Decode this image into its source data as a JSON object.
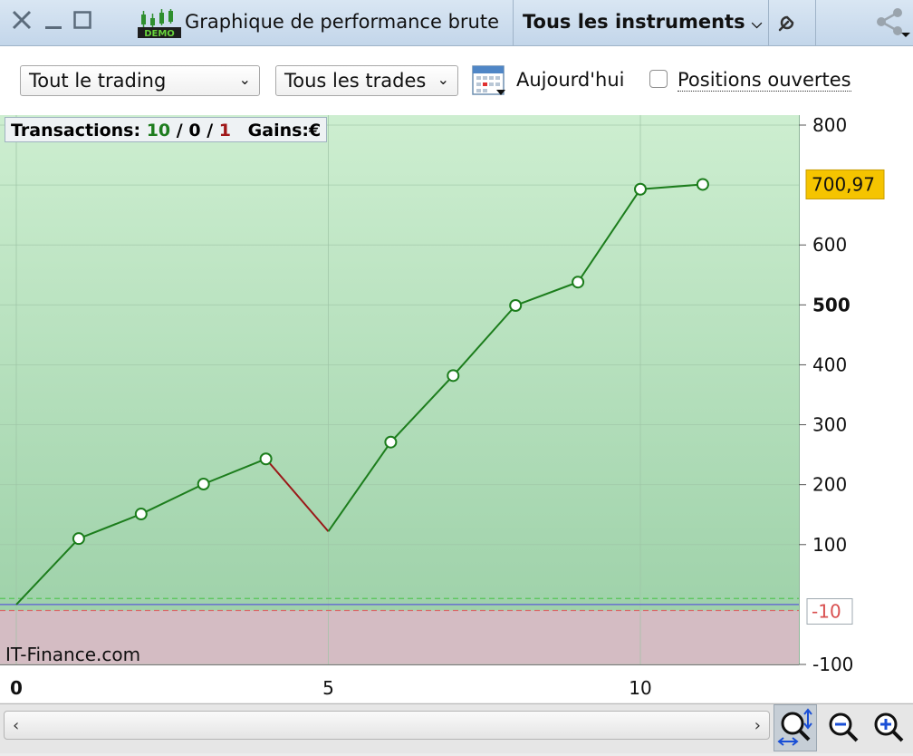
{
  "window": {
    "title": "Graphique de performance brute",
    "instrument_selector": "Tous les instruments",
    "demo_badge": "DEMO",
    "close_icon": "close-icon",
    "minimize_icon": "minimize-icon",
    "maximize_icon": "maximize-icon",
    "settings_icon": "wrench-icon",
    "share_icon": "share-icon"
  },
  "toolbar": {
    "trading_select": "Tout le trading",
    "trades_select": "Tous les trades",
    "date_label": "Aujourd'hui",
    "open_positions_label": "Positions ouvertes",
    "open_positions_checked": false
  },
  "stats": {
    "transactions_label": "Transactions:",
    "wins": "10",
    "sep1": "/",
    "neutral": "0",
    "sep2": "/",
    "losses": "1",
    "gains_label": "Gains:",
    "currency": "€"
  },
  "branding": "IT-Finance.com",
  "current_value_badge": "700,97",
  "marker_label": "-10",
  "chart_data": {
    "type": "line",
    "x": [
      0,
      1,
      2,
      3,
      4,
      5,
      6,
      7,
      8,
      9,
      10,
      11
    ],
    "y": [
      0,
      110,
      151,
      201,
      243,
      122,
      271,
      382,
      499,
      538,
      693,
      701
    ],
    "loss_segment": [
      4,
      5
    ],
    "x_ticks": [
      "0",
      "5",
      "10"
    ],
    "y_ticks": [
      "800",
      "600",
      "500",
      "400",
      "300",
      "200",
      "100",
      "-100"
    ],
    "xlim": [
      0,
      12.5
    ],
    "ylim": [
      -115,
      815
    ],
    "reference_lines": [
      {
        "value": 10,
        "style": "dashed",
        "color": "#55c455"
      },
      {
        "value": -10,
        "style": "dashed",
        "color": "#d96a6a"
      },
      {
        "value": 0,
        "style": "solid",
        "color": "#5c5cd6"
      }
    ],
    "colors": {
      "gain_line": "#1c7d1c",
      "loss_line": "#9a1818",
      "positive_area_top": "#cdeed0",
      "positive_area_bottom": "#9fd2aa",
      "negative_area": "#d4bcc3",
      "badge": "#f5c400"
    },
    "grid": true
  },
  "zoom": {
    "scroll_left_icon": "chevron-left-icon",
    "scroll_right_icon": "chevron-right-icon",
    "fit_icon": "zoom-fit-icon",
    "zoom_out_icon": "zoom-out-icon",
    "zoom_in_icon": "zoom-in-icon"
  }
}
